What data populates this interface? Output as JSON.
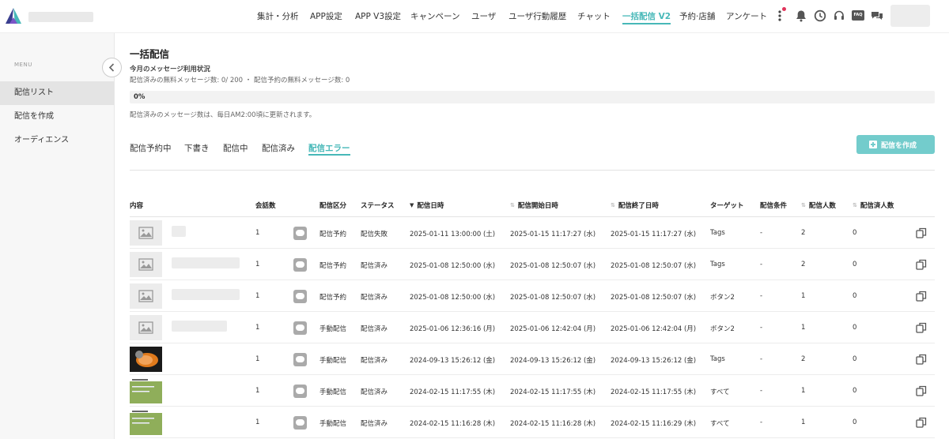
{
  "nav": {
    "items": [
      "集計・分析",
      "APP設定",
      "APP V3設定",
      "キャンペーン",
      "ユーザ",
      "ユーザ行動履歴",
      "チャット",
      "一括配信 V2",
      "予約·店舗",
      "アンケート"
    ],
    "active_index": 7,
    "faq_label": "FAQ"
  },
  "sidebar": {
    "menu_label": "MENU",
    "items": [
      "配信リスト",
      "配信を作成",
      "オーディエンス"
    ],
    "active_index": 0
  },
  "main": {
    "title": "一括配信",
    "subtitle": "今月のメッセージ利用状況",
    "usage_text": "配信済みの無料メッセージ数: 0/ 200 ・ 配信予約の無料メッセージ数: 0",
    "progress_label": "0%",
    "progress_value": 0,
    "note": "配信済みのメッセージ数は、毎日AM2:00頃に更新されます。",
    "tabs": [
      "配信予約中",
      "下書き",
      "配信中",
      "配信済み",
      "配信エラー"
    ],
    "active_tab": 4,
    "create_button": "配信を作成"
  },
  "table": {
    "headers": [
      "内容",
      "会話数",
      "配信区分",
      "ステータス",
      "配信日時",
      "配信開始日時",
      "配信終了日時",
      "ターゲット",
      "配信条件",
      "配信人数",
      "配信済人数"
    ],
    "rows": [
      {
        "talks": "1",
        "type": "配信予約",
        "status": "配信失敗",
        "date": "2025-01-11 13:00:00 (土)",
        "start": "2025-01-15 11:17:27 (水)",
        "end": "2025-01-15 11:17:27 (水)",
        "target": "Tags",
        "cond": "-",
        "count": "2",
        "sent": "0"
      },
      {
        "talks": "1",
        "type": "配信予約",
        "status": "配信済み",
        "date": "2025-01-08 12:50:00 (水)",
        "start": "2025-01-08 12:50:07 (水)",
        "end": "2025-01-08 12:50:07 (水)",
        "target": "Tags",
        "cond": "-",
        "count": "2",
        "sent": "0"
      },
      {
        "talks": "1",
        "type": "配信予約",
        "status": "配信済み",
        "date": "2025-01-08 12:50:00 (水)",
        "start": "2025-01-08 12:50:07 (水)",
        "end": "2025-01-08 12:50:07 (水)",
        "target": "ボタン2",
        "cond": "-",
        "count": "1",
        "sent": "0"
      },
      {
        "talks": "1",
        "type": "手動配信",
        "status": "配信済み",
        "date": "2025-01-06 12:36:16 (月)",
        "start": "2025-01-06 12:42:04 (月)",
        "end": "2025-01-06 12:42:04 (月)",
        "target": "ボタン2",
        "cond": "-",
        "count": "1",
        "sent": "0"
      },
      {
        "talks": "1",
        "type": "手動配信",
        "status": "配信済み",
        "date": "2024-09-13 15:26:12 (金)",
        "start": "2024-09-13 15:26:12 (金)",
        "end": "2024-09-13 15:26:12 (金)",
        "target": "Tags",
        "cond": "-",
        "count": "2",
        "sent": "0"
      },
      {
        "talks": "1",
        "type": "手動配信",
        "status": "配信済み",
        "date": "2024-02-15 11:17:55 (木)",
        "start": "2024-02-15 11:17:55 (木)",
        "end": "2024-02-15 11:17:55 (木)",
        "target": "すべて",
        "cond": "-",
        "count": "1",
        "sent": "0"
      },
      {
        "talks": "1",
        "type": "手動配信",
        "status": "配信済み",
        "date": "2024-02-15 11:16:28 (木)",
        "start": "2024-02-15 11:16:28 (木)",
        "end": "2024-02-15 11:16:29 (木)",
        "target": "すべて",
        "cond": "-",
        "count": "1",
        "sent": "0"
      }
    ]
  },
  "colors": {
    "accent": "#47b8b8",
    "button": "#73cccc",
    "notification": "#e0335a"
  }
}
